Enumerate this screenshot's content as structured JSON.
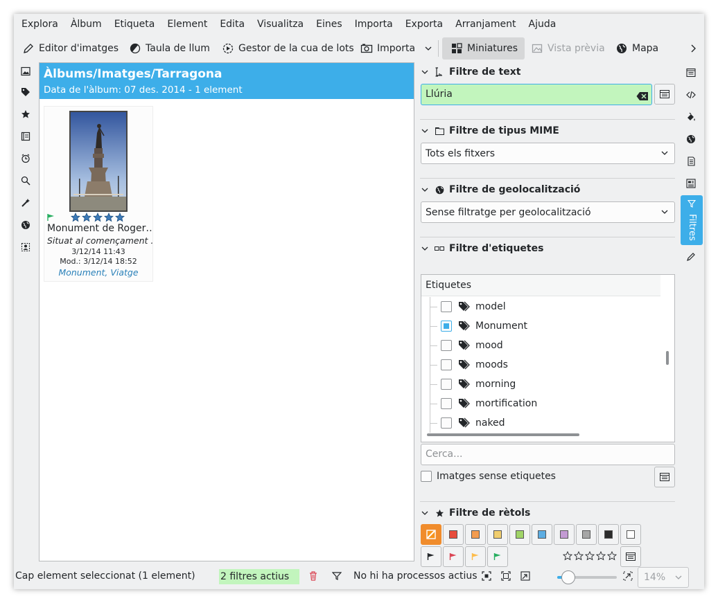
{
  "menubar": [
    "Explora",
    "Àlbum",
    "Etiqueta",
    "Element",
    "Edita",
    "Visualitza",
    "Eines",
    "Importa",
    "Exporta",
    "Arranjament",
    "Ajuda"
  ],
  "toolbar": {
    "image_editor": "Editor d'imatges",
    "light_table": "Taula de llum",
    "batch_queue": "Gestor de la cua de lots",
    "import": "Importa",
    "thumbnails": "Miniatures",
    "preview": "Vista prèvia",
    "map": "Mapa"
  },
  "album": {
    "title": "Àlbums/Imatges/Tarragona",
    "subtitle": "Data de l'àlbum: 07 des. 2014 - 1 element",
    "item": {
      "name": "Monument de Roger…",
      "comment": "Situat al començament …",
      "date": "3/12/14 11:43",
      "modified": "Mod.: 3/12/14 18:52",
      "tags": "Monument, Viatge",
      "rating": 5,
      "flag_color": "#27ae60"
    }
  },
  "filters": {
    "text": {
      "title": "Filtre de text",
      "value": "Llúria",
      "bg": "#c2f5bd"
    },
    "mime": {
      "title": "Filtre de tipus MIME",
      "selected": "Tots els fitxers"
    },
    "geo": {
      "title": "Filtre de geolocalització",
      "selected": "Sense filtratge per geolocalització"
    },
    "tags": {
      "title": "Filtre d'etiquetes",
      "column": "Etiquetes",
      "items": [
        {
          "label": "model",
          "checked": false
        },
        {
          "label": "Monument",
          "checked": true
        },
        {
          "label": "mood",
          "checked": false
        },
        {
          "label": "moods",
          "checked": false
        },
        {
          "label": "morning",
          "checked": false
        },
        {
          "label": "mortification",
          "checked": false
        },
        {
          "label": "naked",
          "checked": false
        }
      ],
      "search_placeholder": "Cerca...",
      "untagged_label": "Imatges sense etiquetes"
    },
    "labels": {
      "title": "Filtre de rètols",
      "colors": [
        "#f7941d",
        "#e74c3c",
        "#f39c4f",
        "#f0cd6e",
        "#a0d468",
        "#5dade2",
        "#c39bd3",
        "#a6a6a6",
        "#2c2c2c",
        "#ffffff"
      ],
      "flags": [
        "#232629",
        "#da4453",
        "#fdbc4b",
        "#27ae60"
      ]
    }
  },
  "right_sidebar": {
    "active_tab": "Filtres"
  },
  "status": {
    "selection": "Cap element seleccionat (1 element)",
    "active_filters": "2 filtres actius",
    "processes": "No hi ha processos actius",
    "zoom": "14%",
    "zoom_level": 0.09
  }
}
